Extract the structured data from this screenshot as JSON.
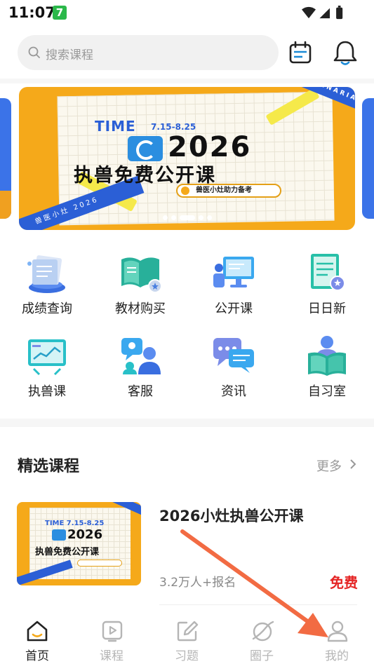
{
  "status_bar": {
    "time": "11:07",
    "app_badge": "7"
  },
  "search": {
    "placeholder": "搜索课程"
  },
  "banner": {
    "ribbon_text": "VETERINARIAN",
    "time_label": "TIME",
    "date_range": "7.15-8.25",
    "year": "2026",
    "title": "执兽免费公开课",
    "pill_text": "兽医小灶助力备考",
    "corner_text": "兽医小灶  2026",
    "dot_count": 5,
    "active_dot": 2
  },
  "grid": [
    {
      "label": "成绩查询",
      "icon": "score-query-icon"
    },
    {
      "label": "教材购买",
      "icon": "textbook-icon"
    },
    {
      "label": "公开课",
      "icon": "open-class-icon"
    },
    {
      "label": "日日新",
      "icon": "daily-new-icon"
    },
    {
      "label": "执兽课",
      "icon": "vet-course-icon"
    },
    {
      "label": "客服",
      "icon": "customer-service-icon"
    },
    {
      "label": "资讯",
      "icon": "news-icon"
    },
    {
      "label": "自习室",
      "icon": "study-room-icon"
    }
  ],
  "courses_section": {
    "title": "精选课程",
    "more": "更多"
  },
  "course": {
    "title": "2026小灶执兽公开课",
    "enrolled": "3.2万人+报名",
    "price": "免费",
    "thumb_time": "TIME 7.15-8.25",
    "thumb_year": "2026",
    "thumb_title": "执兽免费公开课"
  },
  "bottom_nav": [
    {
      "label": "首页",
      "icon": "home-icon",
      "active": true
    },
    {
      "label": "课程",
      "icon": "course-play-icon",
      "active": false
    },
    {
      "label": "习题",
      "icon": "exercise-edit-icon",
      "active": false
    },
    {
      "label": "圈子",
      "icon": "circle-community-icon",
      "active": false
    },
    {
      "label": "我的",
      "icon": "profile-icon",
      "active": false
    }
  ],
  "colors": {
    "accent_orange": "#f5a91a",
    "brand_blue": "#2b5fd6",
    "price_red": "#e52525",
    "arrow": "#f26b43"
  }
}
